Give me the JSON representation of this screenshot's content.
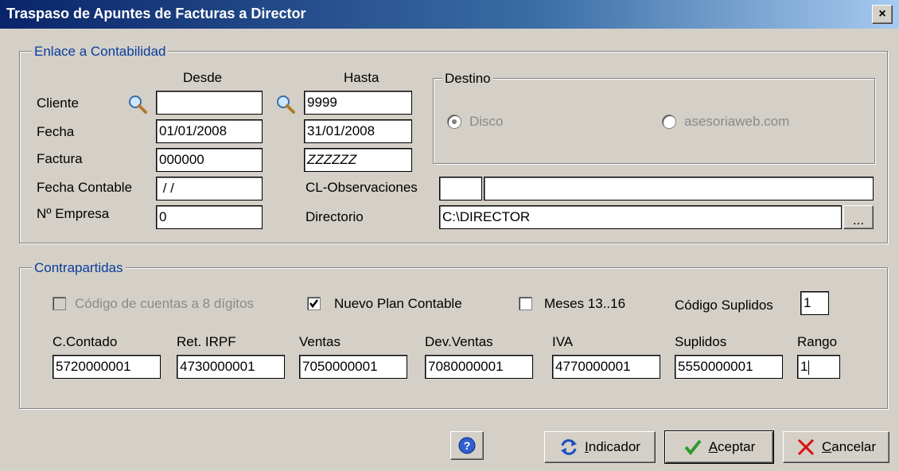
{
  "window": {
    "title": "Traspaso de Apuntes de Facturas a Director",
    "close_label": "×"
  },
  "enlace": {
    "legend": "Enlace a Contabilidad",
    "desde_header": "Desde",
    "hasta_header": "Hasta",
    "cliente_label": "Cliente",
    "fecha_label": "Fecha",
    "factura_label": "Factura",
    "fecha_contable_label": "Fecha Contable",
    "empresa_label": "Nº Empresa",
    "cl_obs_label": "CL-Observaciones",
    "directorio_label": "Directorio",
    "cliente_desde": "",
    "cliente_hasta": "9999",
    "fecha_desde": "01/01/2008",
    "fecha_hasta": "31/01/2008",
    "factura_desde": "000000",
    "factura_hasta": "ZZZZZZ",
    "fecha_contable": " / /",
    "empresa": "0",
    "cl_obs_code": "",
    "cl_obs_text": "",
    "directorio": "C:\\DIRECTOR",
    "browse_label": "..."
  },
  "destino": {
    "legend": "Destino",
    "options": [
      {
        "label": "Disco",
        "checked": true
      },
      {
        "label": "asesoriaweb.com",
        "checked": false
      }
    ]
  },
  "contrapartidas": {
    "legend": "Contrapartidas",
    "cb_cuentas8_label": "Código de cuentas a 8 dígitos",
    "cb_cuentas8_checked": false,
    "cb_nuevo_plan_label": "Nuevo Plan Contable",
    "cb_nuevo_plan_checked": true,
    "cb_meses_label": "Meses 13..16",
    "cb_meses_checked": false,
    "codigo_suplidos_label": "Código Suplidos",
    "codigo_suplidos": "1",
    "columns": [
      {
        "label": "C.Contado",
        "value": "5720000001"
      },
      {
        "label": "Ret. IRPF",
        "value": "4730000001"
      },
      {
        "label": "Ventas",
        "value": "7050000001"
      },
      {
        "label": "Dev.Ventas",
        "value": "7080000001"
      },
      {
        "label": "IVA",
        "value": "4770000001"
      },
      {
        "label": "Suplidos",
        "value": "5550000001"
      },
      {
        "label": "Rango",
        "value": "1"
      }
    ]
  },
  "buttons": {
    "help_icon": "question-icon",
    "indicador": {
      "accel": "I",
      "rest": "ndicador"
    },
    "aceptar": {
      "accel": "A",
      "rest": "ceptar"
    },
    "cancelar": {
      "accel": "C",
      "rest": "ancelar"
    }
  },
  "colors": {
    "title_bar": "#0a246a",
    "legend_text": "#0a3c9c",
    "face": "#d4d0c8",
    "ok_check": "#2e9a2e",
    "cancel_x": "#d81010"
  }
}
